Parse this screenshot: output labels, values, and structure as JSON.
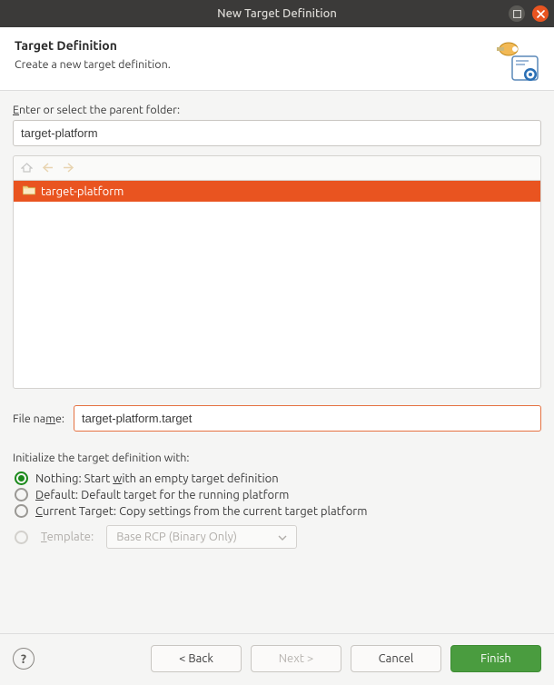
{
  "window": {
    "title": "New Target Definition"
  },
  "header": {
    "title": "Target Definition",
    "subtitle": "Create a new target definition."
  },
  "parentFolder": {
    "label_pre": "E",
    "label_post": "nter or select the parent folder:",
    "value": "target-platform"
  },
  "tree": {
    "items": [
      {
        "label": "target-platform",
        "selected": true
      }
    ]
  },
  "filename": {
    "label_pre": "File na",
    "label_u": "m",
    "label_post": "e:",
    "value": "target-platform.target"
  },
  "initialize": {
    "label": "Initialize the target definition with:",
    "options": {
      "nothing_pre": "Nothing: Start ",
      "nothing_u": "w",
      "nothing_post": "ith an empty target definition",
      "default_u": "D",
      "default_post": "efault: Default target for the running platform",
      "current_u": "C",
      "current_post": "urrent Target: Copy settings from the current target platform",
      "template_u": "T",
      "template_post": "emplate:",
      "template_value": "Base RCP (Binary Only)"
    }
  },
  "buttons": {
    "back": "< Back",
    "next": "Next >",
    "cancel": "Cancel",
    "finish": "Finish"
  }
}
